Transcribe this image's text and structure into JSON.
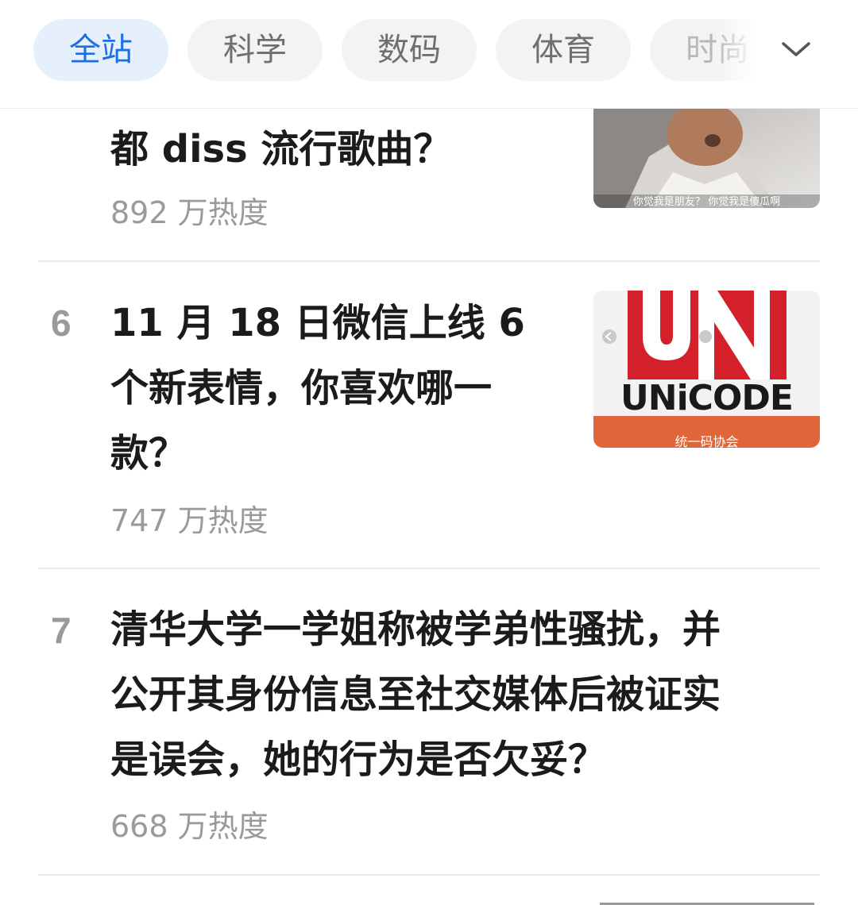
{
  "tabs": [
    {
      "label": "全站",
      "active": true
    },
    {
      "label": "科学",
      "active": false
    },
    {
      "label": "数码",
      "active": false
    },
    {
      "label": "体育",
      "active": false
    },
    {
      "label": "时尚",
      "active": false
    }
  ],
  "more_icon": "chevron-down-icon",
  "items": [
    {
      "rank": "",
      "title_line": "都 diss 流行歌曲？",
      "heat": "892 万热度",
      "thumb_caption": "你觉我是朋友？ 你觉我是傻瓜啊"
    },
    {
      "rank": "6",
      "title_lines": [
        "11 月 18 日微信上线 6",
        "个新表情，你喜欢哪一",
        "款？"
      ],
      "heat": "747 万热度",
      "thumb_logo": "UNiCODE",
      "thumb_caption": "统一码协会"
    },
    {
      "rank": "7",
      "title_lines": [
        "清华大学一学姐称被学弟性骚扰，并",
        "公开其身份信息至社交媒体后被证实",
        "是误会，她的行为是否欠妥？"
      ],
      "heat": "668 万热度"
    }
  ],
  "colors": {
    "accent": "#1d6fe0",
    "active_tab_bg": "#e6f0fc",
    "tab_bg": "#f3f3f3",
    "unicode_red": "#d4202a",
    "unicode_orange": "#e0663a"
  }
}
